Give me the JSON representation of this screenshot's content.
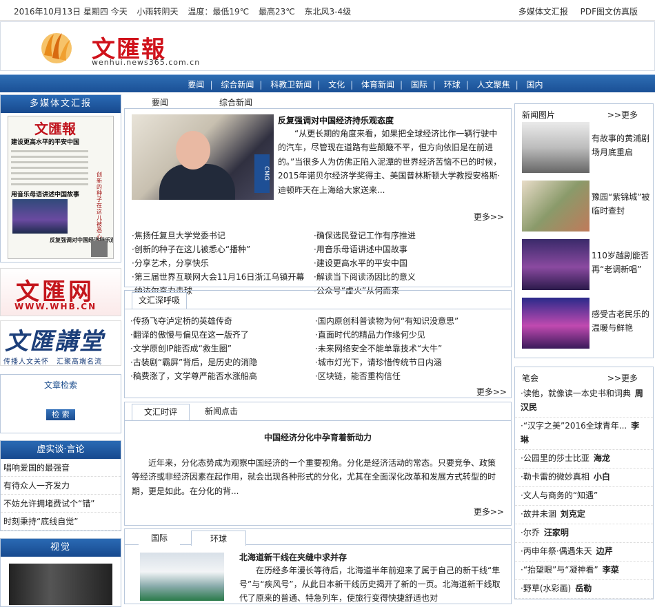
{
  "topbar": {
    "date": "2016年10月13日 星期四 今天",
    "weather": "小雨转阴天",
    "temp_low": "温度：最低19℃",
    "temp_high": "最高23℃",
    "wind": "东北风3-4级",
    "link_multimedia": "多媒体文汇报",
    "link_pdf": "PDF图文仿真版"
  },
  "masthead": {
    "logo_text": "文匯報",
    "logo_url": "wenhui.news365.com.cn"
  },
  "nav": [
    "要闻",
    "综合新闻",
    "科教卫新闻",
    "文化",
    "体育新闻",
    "国际",
    "环球",
    "人文聚焦",
    "国内"
  ],
  "nav_sep": "|",
  "left": {
    "multimedia_title": "多媒体文汇报",
    "np_title": "文匯報",
    "np_head1": "建设更高水平的平安中国",
    "np_head2": "用音乐母语讲述中国故事",
    "np_vert": "创新的种子在这儿被悉心播种",
    "np_head3": "反复强调对中国经济持乐观态度",
    "whb_logo": "文匯网",
    "whb_url": "WWW.WHB.CN",
    "jiangtang_logo": "文匯講堂",
    "jiangtang_slogan": "传播人文关怀　汇聚高端名流",
    "search_title": "文章检索",
    "search_button": "检 索",
    "xsh_title": "虚实谈·言论",
    "xsh_items": [
      "唱响爱国的最强音",
      "有待众人一齐发力",
      "不妨允许拥堵费试个“错”",
      "时刻秉持“底线自觉”"
    ],
    "video_title": "视觉"
  },
  "main": {
    "tabs": [
      "要闻",
      "综合新闻"
    ],
    "lead_title": "反复强调对中国经济持乐观态度",
    "lead_body": "“从更长期的角度来看，如果把全球经济比作一辆行驶中的汽车，尽管现在道路有些颠簸不平，但方向依旧是在前进的。”当很多人为仿佛正陷入泥潭的世界经济苦恼不已的时候，2015年诺贝尔经济学奖得主、美国普林斯顿大学教授安格斯·迪顿昨天在上海给大家送来...",
    "photo_tag": "CMG",
    "more": "更多>>",
    "news_left": [
      "·焦扬任复旦大学党委书记",
      "·创新的种子在这儿被悉心“播种”",
      "·分享艺术，分享快乐",
      "·第三届世界互联网大会11月16日浙江乌镇开幕",
      "·纳达尔奋力击球"
    ],
    "news_right": [
      "·确保选民登记工作有序推进",
      "·用音乐母语讲述中国故事",
      "·建设更高水平的平安中国",
      "·解读当下阅读汤因比的意义",
      "·公众号“虚火”从何而来"
    ],
    "deep_tab": "文汇深呼吸",
    "deep_left": [
      "·传扬飞夺泸定桥的英雄传奇",
      "·翻译的傲慢与偏见在这一版齐了",
      "·文学原创IP能否成“救生圈”",
      "·古装剧“霸屏”背后，是历史的消隐",
      "·稿费涨了，文学尊严能否水涨船高"
    ],
    "deep_right": [
      "·国内原创科普读物为何“有知识没意思”",
      "·直面时代的精品力作缘何少见",
      "·未来网络安全不能单靠技术“大牛”",
      "·城市灯光下，请珍惜传统节日内涵",
      "·区块链，能否重构信任"
    ],
    "comment_tabs": [
      "文汇时评",
      "新闻点击"
    ],
    "comment_title": "中国经济分化中孕育着新动力",
    "comment_body": "近年来，分化态势成为观察中国经济的一个重要视角。分化是经济活动的常态。只要竞争、政策等经济或非经济因素在起作用，就会出现各种形式的分化，尤其在全面深化改革和发展方式转型的时期，更是如此。在分化的背...",
    "world_tabs": [
      "国际",
      "环球"
    ],
    "world_title": "北海道新干线在夹缝中求并存",
    "world_body": "在历经多年漫长等待后，北海道半年前迎来了属于自己的新干线“隼号”与“疾风号”，从此日本新干线历史揭开了新的一页。北海道新干线取代了原来的普通、特急列车，使旅行变得快捷舒适也对"
  },
  "right": {
    "pics_title": "新闻图片",
    "pics_more": ">>更多",
    "pics": [
      {
        "caption": "有故事的黄浦剧场月底重启"
      },
      {
        "caption": "豫园“紫锦城”被临时查封"
      },
      {
        "caption": "110岁越剧能否再“老调新唱”"
      },
      {
        "caption": "感受古老民乐的温暖与鲜艳"
      }
    ],
    "essay_title": "笔会",
    "essay_more": ">>更多",
    "essays": [
      {
        "title": "·读他，就像读一本史书和词典",
        "author": "周汉民"
      },
      {
        "title": "·“汉字之美”2016全球青年...",
        "author": "李琳"
      },
      {
        "title": "·公园里的莎士比亚",
        "author": "海龙"
      },
      {
        "title": "·勒卡雷的微妙真相",
        "author": "小白"
      },
      {
        "title": "·文人与商务的“知遇”",
        "author": ""
      },
      {
        "title": "·故井未涸",
        "author": "刘克定"
      },
      {
        "title": "·尔乔",
        "author": "汪家明"
      },
      {
        "title": "·丙申年祭·偶遇朱天",
        "author": "边芹"
      },
      {
        "title": "·“抬望眼”与“凝神看”",
        "author": "李菜"
      },
      {
        "title": "·野草(水彩画)",
        "author": "岳勒"
      }
    ]
  }
}
